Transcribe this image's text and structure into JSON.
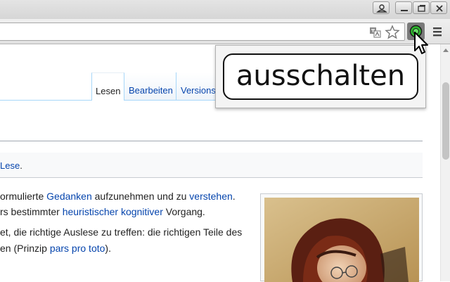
{
  "window": {
    "buttons": [
      "user",
      "minimize",
      "restore",
      "close"
    ]
  },
  "toolbar": {
    "icons": [
      "translate-icon",
      "star-icon",
      "extension-icon",
      "menu-icon"
    ]
  },
  "tooltip": {
    "text": "ausschalten"
  },
  "article": {
    "tabs": [
      {
        "label": "Lesen",
        "active": true
      },
      {
        "label": "Bearbeiten",
        "active": false
      },
      {
        "label": "Versions",
        "active": false
      }
    ],
    "notice": {
      "link": "Lese",
      "suffix": "."
    },
    "paragraphs": {
      "p1_line1": {
        "t1": "ormulierte ",
        "l1": "Gedanken",
        "t2": " aufzunehmen und zu ",
        "l2": "verstehen",
        "t3": "."
      },
      "p1_line2": {
        "t1": "rs bestimmter ",
        "l1": "heuristischer",
        "t2": " ",
        "l2": "kognitiver",
        "t3": " Vorgang."
      },
      "p2_line1": {
        "t1": "et, die richtige Auslese zu treffen: die richtigen Teile des"
      },
      "p2_line2": {
        "t1": "en (Prinzip ",
        "l1": "pars pro toto",
        "t2": ")."
      }
    }
  },
  "colors": {
    "link": "#0645ad",
    "text": "#222222",
    "extension_green": "#2fb52f"
  }
}
